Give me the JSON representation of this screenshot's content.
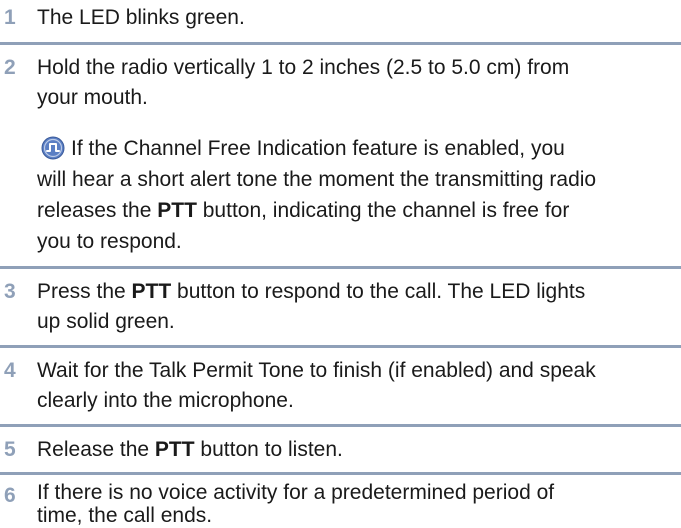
{
  "steps": [
    {
      "number": "1",
      "text": "The LED blinks green."
    },
    {
      "number": "2",
      "text_line1": "Hold the radio vertically 1 to 2 inches (2.5 to 5.0 cm) from",
      "text_line2": "your mouth.",
      "note": {
        "icon": "channel-free-indication-icon",
        "line1": "If the Channel Free Indication feature is enabled, you",
        "line2": "will hear a short alert tone the moment the transmitting radio",
        "line3_pre": "releases the ",
        "line3_bold": "PTT",
        "line3_post": " button, indicating the channel is free for",
        "line4": "you to respond."
      }
    },
    {
      "number": "3",
      "pre": "Press the ",
      "bold": "PTT",
      "post": " button to respond to the call. The LED lights",
      "line2": "up solid green."
    },
    {
      "number": "4",
      "line1": "Wait for the Talk Permit Tone to finish (if enabled) and speak",
      "line2": "clearly into the microphone."
    },
    {
      "number": "5",
      "pre": "Release the ",
      "bold": "PTT",
      "post": " button to listen."
    },
    {
      "number": "6",
      "line1": "If there is no voice activity for a predetermined period of",
      "line2": "time, the call ends."
    }
  ],
  "colors": {
    "number": "#8fa0b8",
    "rule": "#8fa0b8",
    "icon_fill": "#5b7fc4",
    "text": "#1a1a1a"
  }
}
